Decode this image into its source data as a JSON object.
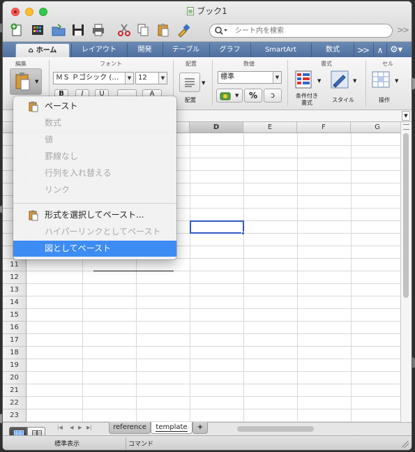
{
  "window": {
    "title": "ブック1"
  },
  "toolbar": {
    "search_placeholder": "シート内を検索",
    "overflow": ">>"
  },
  "ribbon_tabs": [
    {
      "label": "ホーム"
    },
    {
      "label": "レイアウト"
    },
    {
      "label": "開発"
    },
    {
      "label": "テーブル"
    },
    {
      "label": "グラフ"
    },
    {
      "label": "SmartArt"
    },
    {
      "label": "数式"
    }
  ],
  "ribbon": {
    "groups": {
      "edit": "編集",
      "font": "フォント",
      "align": "配置",
      "number": "数値",
      "format": "書式",
      "cells": "セル"
    },
    "font_name": "ＭＳ Ｐゴシック (…",
    "font_size": "12",
    "number_format": "標準",
    "align_button": "配置",
    "conditional_format": "条件付き\n書式",
    "style_button": "スタイル",
    "cells_button": "操作",
    "percent": "%"
  },
  "grid": {
    "columns": [
      "D",
      "E",
      "F",
      "G"
    ],
    "selected_column": "D",
    "rows": [
      "11",
      "12",
      "13",
      "14",
      "15",
      "16",
      "17",
      "18",
      "19",
      "20",
      "21",
      "22",
      "23"
    ]
  },
  "paste_menu": {
    "items": [
      {
        "label": "ペースト",
        "enabled": true,
        "icon": "clipboard-icon"
      },
      {
        "label": "数式",
        "enabled": false
      },
      {
        "label": "値",
        "enabled": false
      },
      {
        "label": "罫線なし",
        "enabled": false
      },
      {
        "label": "行列を入れ替える",
        "enabled": false
      },
      {
        "label": "リンク",
        "enabled": false
      },
      {
        "label": "形式を選択してペースト...",
        "enabled": true,
        "icon": "clipboard-icon"
      },
      {
        "label": "ハイパーリンクとしてペースト",
        "enabled": false
      },
      {
        "label": "図としてペースト",
        "enabled": true,
        "highlighted": true
      }
    ]
  },
  "sheets": [
    {
      "label": "reference",
      "active": false
    },
    {
      "label": "template",
      "active": true
    }
  ],
  "status": {
    "mode": "標準表示",
    "command": "コマンド"
  },
  "colors": {
    "ribbon_tab_bar": "#5a79a8",
    "highlight": "#3d8cf3",
    "active_cell_border": "#2f59c9"
  }
}
